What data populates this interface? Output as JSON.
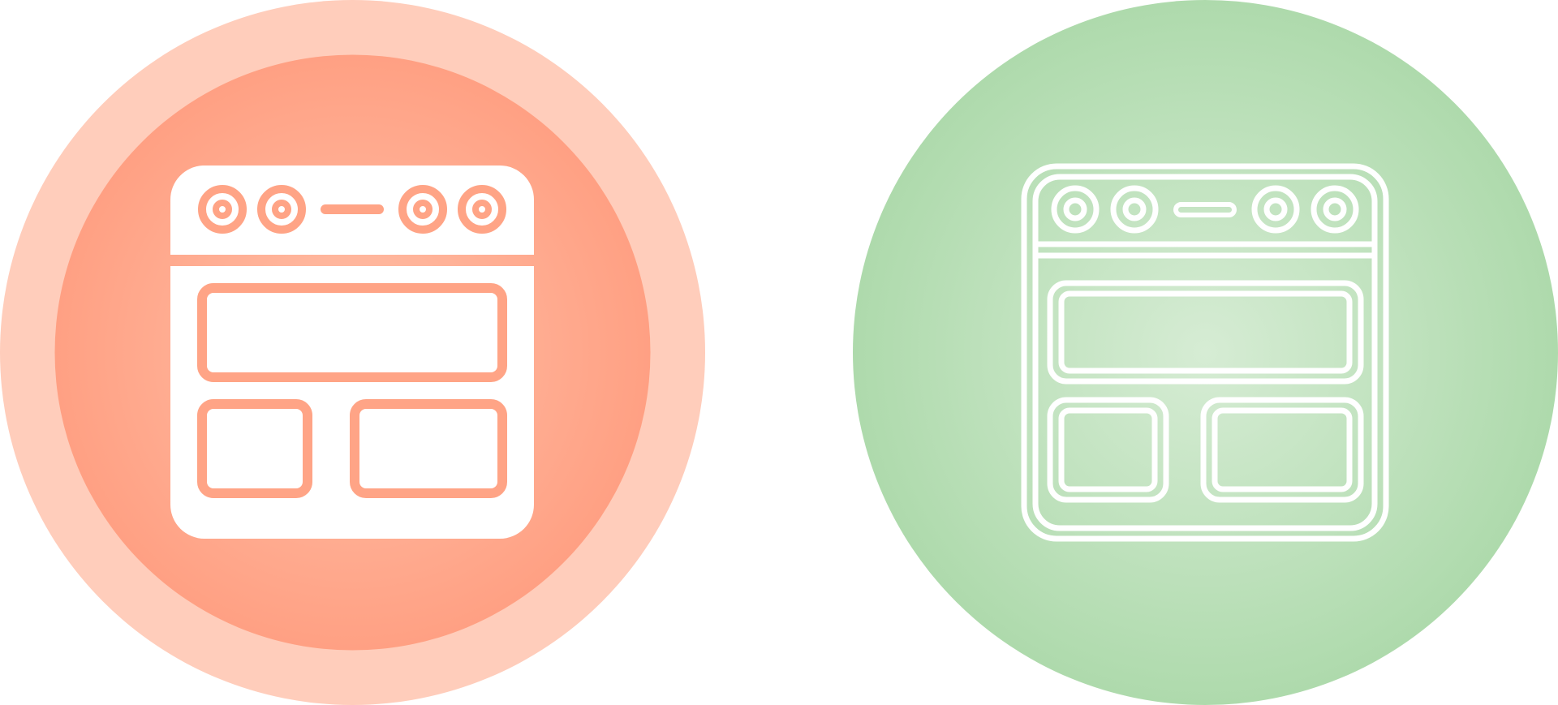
{
  "icons": [
    {
      "name": "oven-icon-filled",
      "style": "filled",
      "colors": {
        "outer_ring": "#ffcdbb",
        "inner_circle_center": "#ffc0a8",
        "inner_circle_edge": "#ffa083",
        "glyph": "#ffffff",
        "glyph_detail": "#ffa486"
      }
    },
    {
      "name": "oven-icon-outline",
      "style": "outline",
      "colors": {
        "circle_center": "#d6ecd4",
        "circle_edge": "#aedaac",
        "glyph": "#ffffff"
      }
    }
  ]
}
